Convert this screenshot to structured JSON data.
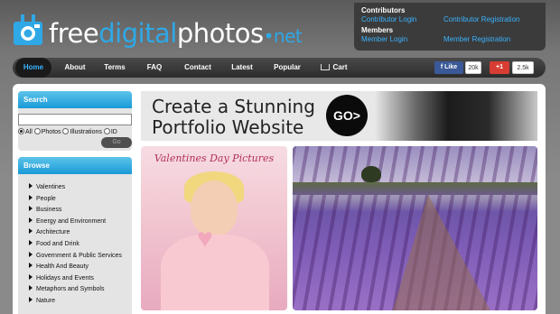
{
  "header": {
    "logo": {
      "part1": "free",
      "part2": "digital",
      "part3": "photos",
      "part4": "•net"
    },
    "account": {
      "contributors_heading": "Contributors",
      "contributor_login": "Contributor Login",
      "contributor_registration": "Contributor Registration",
      "members_heading": "Members",
      "member_login": "Member Login",
      "member_registration": "Member Registration"
    }
  },
  "nav": {
    "items": [
      "Home",
      "About",
      "Terms",
      "FAQ",
      "Contact",
      "Latest",
      "Popular",
      "Cart"
    ],
    "active": "Home",
    "social": {
      "facebook_label": "Like",
      "facebook_count": "20k",
      "gplus_label": "+1",
      "gplus_count": "2.5k"
    }
  },
  "sidebar": {
    "search": {
      "title": "Search",
      "input_value": "",
      "options": [
        "All",
        "Photos",
        "Illustrations",
        "ID"
      ],
      "selected": "All",
      "go_label": "Go"
    },
    "browse": {
      "title": "Browse",
      "categories": [
        "Valentines",
        "People",
        "Business",
        "Energy and Environment",
        "Architecture",
        "Food and Drink",
        "Government & Public Services",
        "Health And Beauty",
        "Holidays and Events",
        "Metaphors and Symbols",
        "Nature"
      ]
    }
  },
  "banner": {
    "line1": "Create a Stunning",
    "line2": "Portfolio Website",
    "cta": "GO>"
  },
  "featured": {
    "valentine_title": "Valentines Day Pictures"
  },
  "colors": {
    "accent": "#2fa8e6",
    "link": "#3ab3ff",
    "nav_bg": "#2c2c2c",
    "sidebar_header": "#1a9ad6"
  }
}
